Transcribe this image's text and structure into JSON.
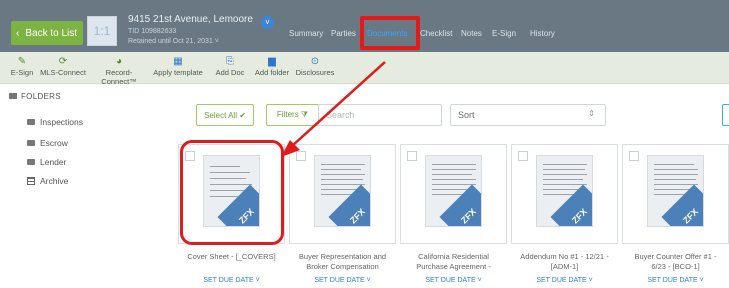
{
  "header": {
    "back_label": "Back to List",
    "back_icon": "chevron-left-icon",
    "thumb_text": "1:1",
    "address": "9415 21st Avenue, Lemoore",
    "tid": "TID 109882633",
    "retained": "Retained until Oct 21, 2031 ˅",
    "tabs": [
      "Summary",
      "Parties",
      "Documents",
      "Checklist",
      "Notes",
      "E-Sign",
      "History"
    ],
    "active_tab": "Documents"
  },
  "toolbar": {
    "items": [
      {
        "label": "E-Sign",
        "icon": "pen-icon"
      },
      {
        "label": "MLS-Connect",
        "icon": "sync-icon"
      },
      {
        "label": "Record-Connect™",
        "icon": "record-icon"
      },
      {
        "label": "Apply template",
        "icon": "template-icon"
      },
      {
        "label": "Add Doc",
        "icon": "add-doc-icon"
      },
      {
        "label": "Add folder",
        "icon": "add-folder-icon"
      },
      {
        "label": "Disclosures",
        "icon": "disclosures-icon"
      }
    ]
  },
  "sidebar": {
    "heading": "FOLDERS",
    "folders": [
      "Inspections",
      "Escrow",
      "Lender",
      "Archive"
    ]
  },
  "filters": {
    "select_all": "Select All ✔",
    "filters_label": "Filters ⧩",
    "search_placeholder": "Search",
    "sort_label": "Sort",
    "sort_arrow": "⇕"
  },
  "documents": [
    {
      "title_1": "Cover Sheet - [_COVERS]",
      "title_2": "",
      "due": "SET DUE DATE ˅"
    },
    {
      "title_1": "Buyer Representation and",
      "title_2": "Broker Compensation",
      "due": "SET DUE DATE ˅"
    },
    {
      "title_1": "California Residential",
      "title_2": "Purchase Agreement -",
      "due": "SET DUE DATE ˅"
    },
    {
      "title_1": "Addendum No #1 - 12/21 -",
      "title_2": "[ADM-1]",
      "due": "SET DUE DATE ˅"
    },
    {
      "title_1": "Buyer Counter Offer #1 -",
      "title_2": "6/23 - [BCO-1]",
      "due": "SET DUE DATE ˅"
    }
  ],
  "annotation": {
    "color": "#e01b1b"
  },
  "zfx_label": "ZFX"
}
